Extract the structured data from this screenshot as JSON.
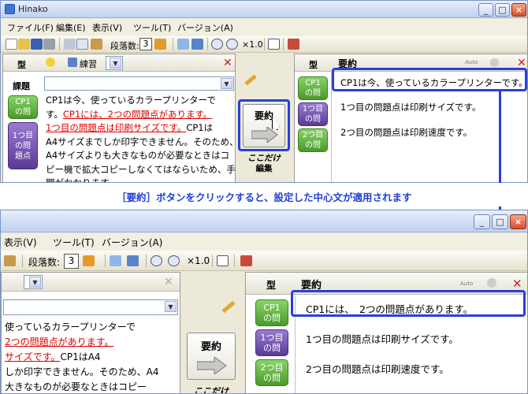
{
  "window": {
    "title": "Hinako"
  },
  "menu": {
    "file": "ファイル(F)",
    "edit": "編集(E)",
    "view": "表示(V)",
    "tools": "ツール(T)",
    "version": "バージョン(A)"
  },
  "toolbar": {
    "paragraphs_label": "段落数:",
    "paragraphs_value": "3",
    "zoom": "×1.0"
  },
  "left_panel": {
    "header_label": "型",
    "style_combo": "練習",
    "assignment_label": "課題",
    "tags": [
      "CP1\nの問",
      "1つ目\nの問\n題点"
    ],
    "text_lines_top": [
      {
        "a": "CP1は今、使っているカラープリンターで",
        "b": ""
      },
      {
        "a": "す。",
        "b": "CP1には、2つの問題点があります。"
      },
      {
        "a": "",
        "b": "1つ目の問題点は印刷サイズです。",
        "c": "CP1は"
      },
      {
        "a": "A4サイズまでしか印字できません。そのため、",
        "b": ""
      },
      {
        "a": "A4サイズよりも大きなものが必要なときはコ",
        "b": ""
      },
      {
        "a": "ピー機で拡大コピーしなくてはならいため、手",
        "b": ""
      },
      {
        "a": "間がかかります。",
        "b": ""
      }
    ],
    "text_lines_bottom": [
      {
        "a": "使っているカラープリンターで",
        "b": ""
      },
      {
        "a": "",
        "b": "2つの問題点があります。"
      },
      {
        "a": "",
        "b": "サイズです。",
        "c": "CP1はA4"
      },
      {
        "a": "しか印字できません。そのため、A4",
        "b": ""
      },
      {
        "a": "大きなものが必要なときはコピー",
        "b": ""
      }
    ]
  },
  "middle": {
    "summary_button": "要約",
    "only_here_label": "ここだけ",
    "edit_label": "編集"
  },
  "right_panel": {
    "header_type": "型",
    "header_summary": "要約",
    "auto_label": "Auto",
    "tags": [
      "CP1\nの問",
      "1つ目\nの問",
      "2つ目\nの問"
    ],
    "top_lines": [
      "CP1は今、使っているカラープリンターです。",
      "1つ目の問題点は印刷サイズです。",
      "2つ目の問題点は印刷速度です。"
    ],
    "bottom_lines": [
      "CP1には、　2つの問題点があります。",
      "1つ目の問題点は印刷サイズです。",
      "2つ目の問題点は印刷速度です。"
    ]
  },
  "callout": "［要約］ボタンをクリックすると、設定した中心文が適用されます",
  "colors": {
    "highlight": "#2a3fd8",
    "red_text": "#dd0000",
    "green_tag": "#5aa838",
    "purple_tag": "#6a4aa6"
  }
}
